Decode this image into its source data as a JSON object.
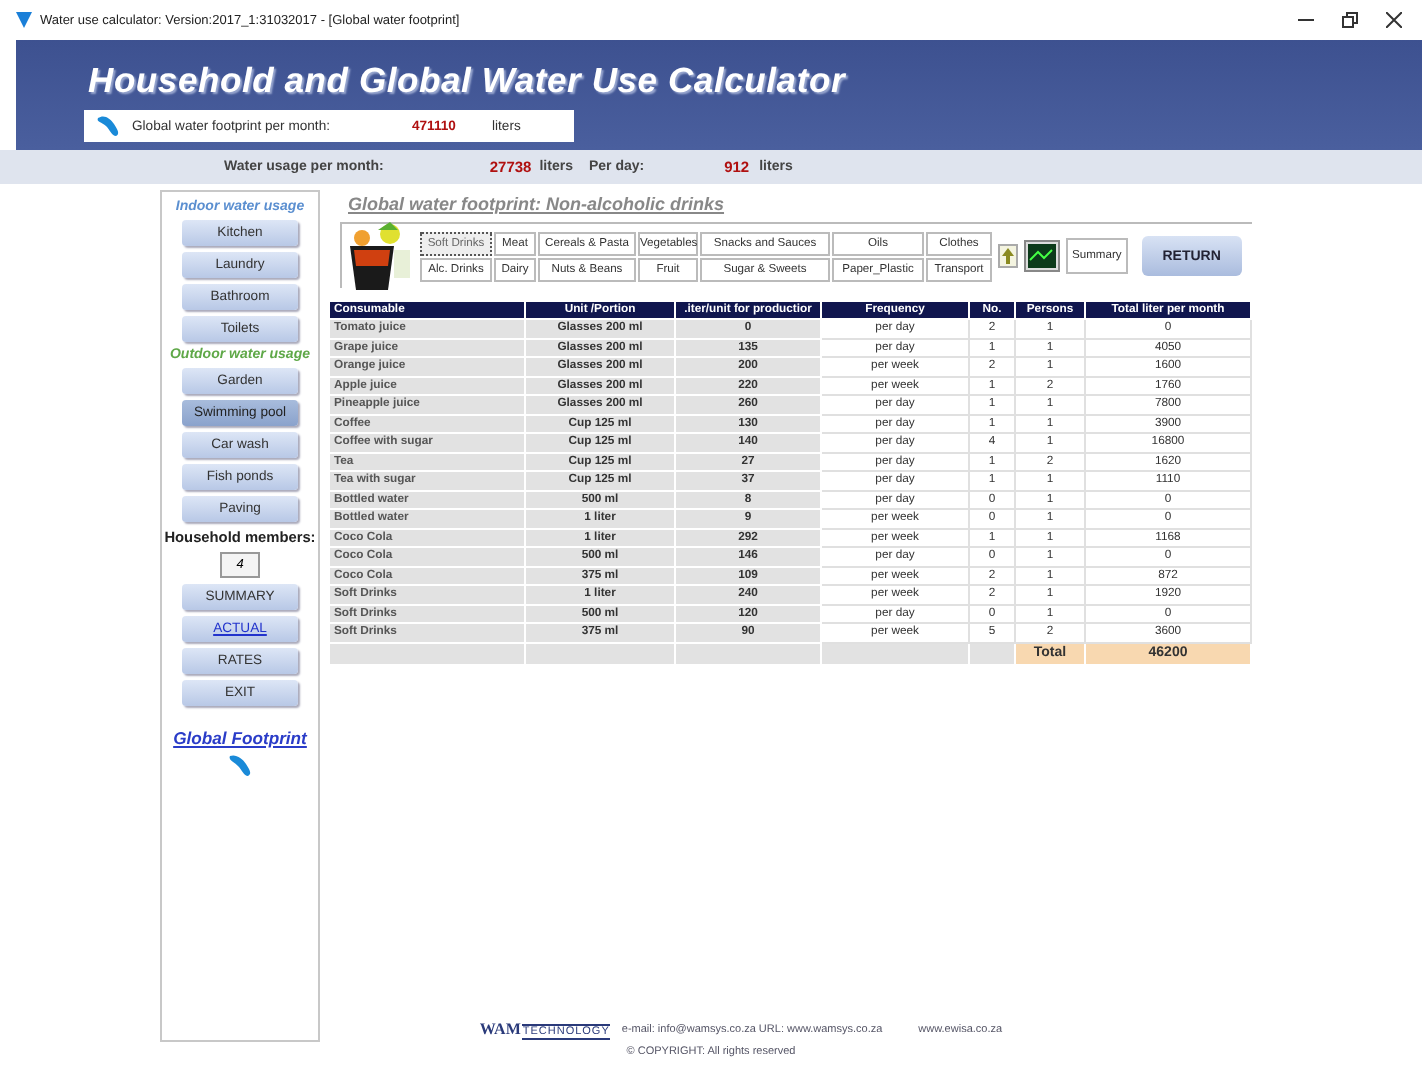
{
  "window": {
    "title": "Water use calculator: Version:2017_1:31032017 - [Global water footprint]"
  },
  "header": {
    "title": "Household and Global Water Use Calculator",
    "footprint_label": "Global water footprint per month:",
    "footprint_value": "471110",
    "footprint_unit": "liters"
  },
  "usage_bar": {
    "month_label": "Water usage per month:",
    "month_value": "27738",
    "month_unit": "liters",
    "day_label": "Per day:",
    "day_value": "912",
    "day_unit": "liters"
  },
  "sidebar": {
    "items": [
      {
        "kind": "heading",
        "label": "Indoor water usage",
        "color": "#5b8fd0"
      },
      {
        "kind": "button",
        "label": "Kitchen",
        "selected": false
      },
      {
        "kind": "button",
        "label": "Laundry",
        "selected": false
      },
      {
        "kind": "button",
        "label": "Bathroom",
        "selected": false
      },
      {
        "kind": "button",
        "label": "Toilets",
        "selected": false
      },
      {
        "kind": "heading",
        "label": "Outdoor water usage",
        "color": "#5fa848"
      },
      {
        "kind": "button",
        "label": "Garden",
        "selected": false
      },
      {
        "kind": "button",
        "label": "Swimming pool",
        "selected": true
      },
      {
        "kind": "button",
        "label": "Car wash",
        "selected": false
      },
      {
        "kind": "button",
        "label": "Fish ponds",
        "selected": false
      },
      {
        "kind": "button",
        "label": "Paving",
        "selected": false
      },
      {
        "kind": "label",
        "label": "Household members:"
      },
      {
        "kind": "field",
        "value": "4"
      },
      {
        "kind": "button",
        "label": "SUMMARY",
        "selected": false
      },
      {
        "kind": "link",
        "label": "ACTUAL"
      },
      {
        "kind": "button",
        "label": "RATES",
        "selected": false
      },
      {
        "kind": "button",
        "label": "EXIT",
        "selected": false
      },
      {
        "kind": "footprint",
        "label": "Global Footprint"
      }
    ]
  },
  "content": {
    "title": "Global water footprint: Non-alcoholic drinks",
    "categories": [
      {
        "label": "Soft Drinks",
        "selected": true
      },
      {
        "label": "Meat",
        "selected": false
      },
      {
        "label": "Cereals & Pasta",
        "selected": false
      },
      {
        "label": "Vegetables",
        "selected": false
      },
      {
        "label": "Snacks and Sauces",
        "selected": false
      },
      {
        "label": "Oils",
        "selected": false
      },
      {
        "label": "Clothes",
        "selected": false
      },
      {
        "label": "Alc. Drinks",
        "selected": false
      },
      {
        "label": "Dairy",
        "selected": false
      },
      {
        "label": "Nuts & Beans",
        "selected": false
      },
      {
        "label": "Fruit",
        "selected": false
      },
      {
        "label": "Sugar & Sweets",
        "selected": false
      },
      {
        "label": "Paper_Plastic",
        "selected": false
      },
      {
        "label": "Transport",
        "selected": false
      }
    ],
    "summary_button": "Summary",
    "return_button": "RETURN"
  },
  "table": {
    "columns": [
      "Consumable",
      "Unit /Portion",
      ".iter/unit for productior",
      "Frequency",
      "No.",
      "Persons",
      "Total liter per month"
    ],
    "rows": [
      [
        "Tomato juice",
        "Glasses 200 ml",
        "0",
        "per day",
        "2",
        "1",
        "0"
      ],
      [
        "Grape juice",
        "Glasses 200 ml",
        "135",
        "per day",
        "1",
        "1",
        "4050"
      ],
      [
        "Orange juice",
        "Glasses 200 ml",
        "200",
        "per week",
        "2",
        "1",
        "1600"
      ],
      [
        "Apple juice",
        "Glasses 200 ml",
        "220",
        "per week",
        "1",
        "2",
        "1760"
      ],
      [
        "Pineapple juice",
        "Glasses 200 ml",
        "260",
        "per day",
        "1",
        "1",
        "7800"
      ],
      [
        "Coffee",
        "Cup 125 ml",
        "130",
        "per day",
        "1",
        "1",
        "3900"
      ],
      [
        "Coffee with sugar",
        "Cup 125 ml",
        "140",
        "per day",
        "4",
        "1",
        "16800"
      ],
      [
        "Tea",
        "Cup 125 ml",
        "27",
        "per day",
        "1",
        "2",
        "1620"
      ],
      [
        "Tea with sugar",
        "Cup 125 ml",
        "37",
        "per day",
        "1",
        "1",
        "1110"
      ],
      [
        "Bottled water",
        "500 ml",
        "8",
        "per day",
        "0",
        "1",
        "0"
      ],
      [
        "Bottled water",
        "1 liter",
        "9",
        "per week",
        "0",
        "1",
        "0"
      ],
      [
        "Coco Cola",
        "1 liter",
        "292",
        "per week",
        "1",
        "1",
        "1168"
      ],
      [
        "Coco Cola",
        "500 ml",
        "146",
        "per day",
        "0",
        "1",
        "0"
      ],
      [
        "Coco Cola",
        "375 ml",
        "109",
        "per week",
        "2",
        "1",
        "872"
      ],
      [
        "Soft Drinks",
        "1 liter",
        "240",
        "per week",
        "2",
        "1",
        "1920"
      ],
      [
        "Soft Drinks",
        "500 ml",
        "120",
        "per day",
        "0",
        "1",
        "0"
      ],
      [
        "Soft Drinks",
        "375 ml",
        "90",
        "per week",
        "5",
        "2",
        "3600"
      ]
    ],
    "total_label": "Total",
    "total_value": "46200"
  },
  "footer": {
    "logo_main": "WAM",
    "logo_sub": "TECHNOLOGY",
    "contact": "e-mail: info@wamsys.co.za   URL: www.wamsys.co.za",
    "website": "www.ewisa.co.za",
    "copyright": "© COPYRIGHT: All rights reserved"
  }
}
